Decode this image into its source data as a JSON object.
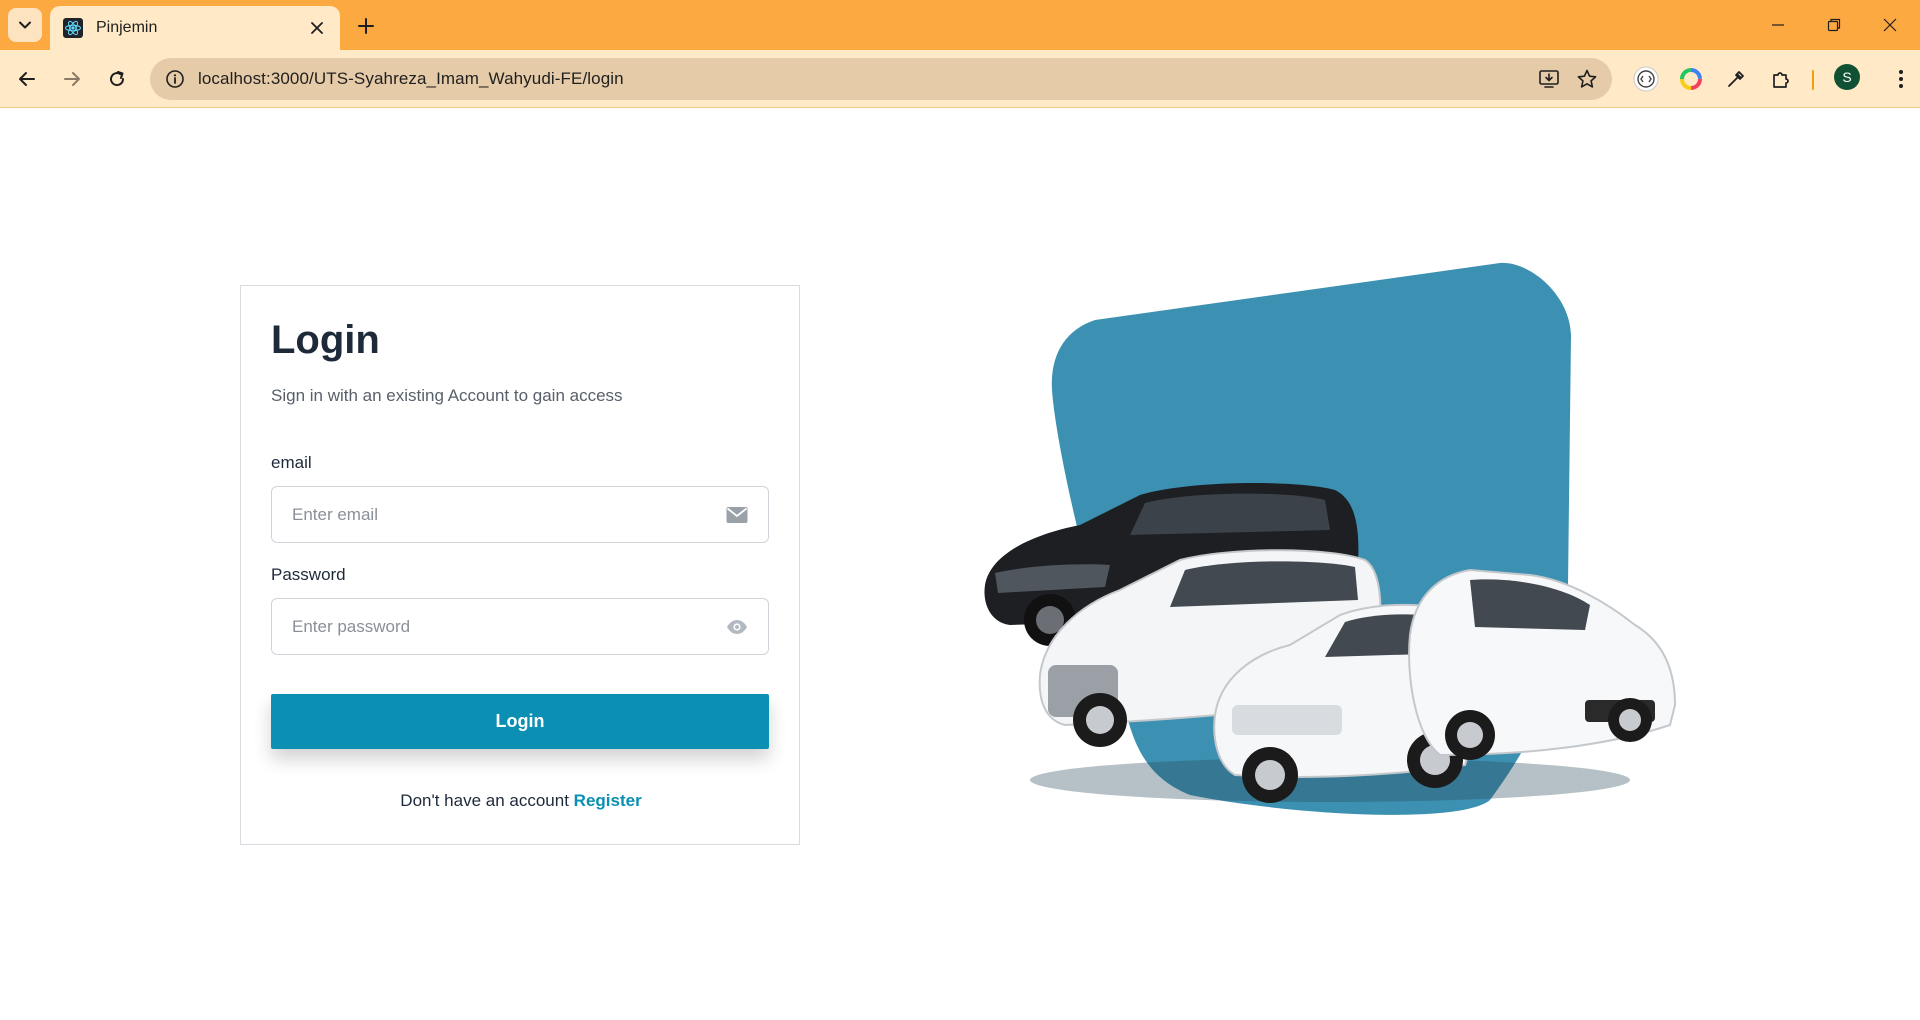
{
  "browser": {
    "tab_title": "Pinjemin",
    "url_host": "localhost",
    "url_path": ":3000/UTS-Syahreza_Imam_Wahyudi-FE/login",
    "profile_initial": "S",
    "theme_color": "#fda942"
  },
  "login": {
    "heading": "Login",
    "subtitle": "Sign in with an existing Account to gain access",
    "email_label": "email",
    "email_placeholder": "Enter email",
    "password_label": "Password",
    "password_placeholder": "Enter password",
    "submit_label": "Login",
    "register_prompt": "Don't have an account",
    "register_link": "Register",
    "accent_color": "#0b8fb3"
  },
  "illustration": {
    "blob_color": "#3c90b1",
    "icon": "cars-illustration"
  }
}
